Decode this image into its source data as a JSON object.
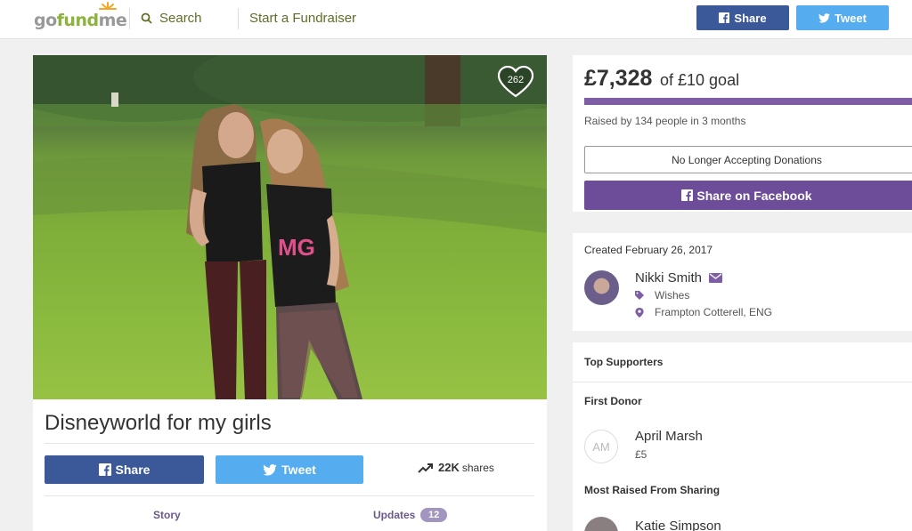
{
  "header": {
    "logo_prefix": "go",
    "logo_main": "fund",
    "logo_suffix": "me",
    "search_label": "Search",
    "start_label": "Start a Fundraiser",
    "share_label": "Share",
    "tweet_label": "Tweet"
  },
  "campaign": {
    "heart_count": "262",
    "title": "Disneyworld for my girls",
    "share_label": "Share",
    "tweet_label": "Tweet",
    "shares_count": "22K",
    "shares_label": "shares",
    "tabs": [
      {
        "label": "Story"
      },
      {
        "label": "Updates",
        "badge": "12"
      }
    ]
  },
  "donation": {
    "amount": "£7,328",
    "goal_text": "of £10 goal",
    "progress_fraction": 1.0,
    "raised_text": "Raised by 134 people in 3 months",
    "no_longer_label": "No Longer Accepting Donations",
    "share_fb_label": "Share on Facebook"
  },
  "organizer": {
    "created_text": "Created February 26, 2017",
    "name": "Nikki Smith",
    "category": "Wishes",
    "location": "Frampton Cotterell, ENG"
  },
  "supporters": {
    "top_heading": "Top Supporters",
    "first_donor_heading": "First Donor",
    "first_donor_initials": "AM",
    "first_donor_name": "April Marsh",
    "first_donor_amount": "£5",
    "most_raised_heading": "Most Raised From Sharing",
    "most_raised_name": "Katie Simpson"
  },
  "colors": {
    "facebook": "#3b5998",
    "twitter": "#55acee",
    "brand_green": "#8cb43d",
    "purple": "#6d4c99",
    "progress": "#7d5ea5"
  },
  "icons": [
    "search-icon",
    "facebook-icon",
    "twitter-icon",
    "heart-icon",
    "trending-icon",
    "envelope-icon",
    "tag-icon",
    "location-pin-icon"
  ]
}
